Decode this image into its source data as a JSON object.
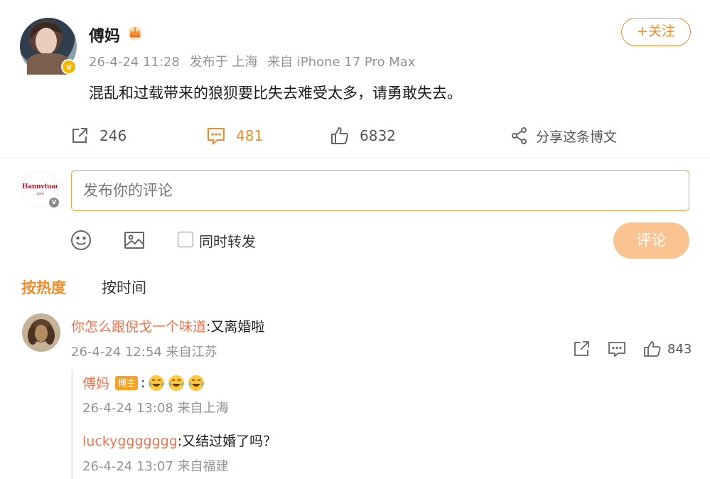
{
  "post": {
    "author": "傅妈",
    "verified_mark": "v",
    "time": "26-4-24 11:28",
    "published_in_prefix": "发布于",
    "location": "上海",
    "source_prefix": "来自",
    "device": "iPhone 17 Pro Max",
    "follow_label": "+关注",
    "text": "混乱和过载带来的狼狈要比失去难受太多，请勇敢失去。",
    "actions": {
      "repost_count": "246",
      "comment_count": "481",
      "like_count": "6832",
      "share_label": "分享这条博文"
    },
    "accent_color": "#f18a2b"
  },
  "composer": {
    "avatar_logo": "Hannvtuan",
    "avatar_logo_sub": ".com",
    "placeholder": "发布你的评论",
    "repost_checkbox_label": "同时转发",
    "submit_label": "评论"
  },
  "sort": {
    "hot_label": "按热度",
    "time_label": "按时间",
    "active": "hot"
  },
  "comments": [
    {
      "name": "你怎么跟倪戈一个味道",
      "separator": ":",
      "text": "又离婚啦",
      "time": "26-4-24 12:54",
      "source": "来自江苏",
      "like_count": "843",
      "replies": [
        {
          "name": "傅妈",
          "badge": "博主",
          "separator": ":",
          "emoji_icons": [
            "laugh-cry-icon",
            "laugh-cry-icon",
            "laugh-cry-icon"
          ],
          "time": "26-4-24 13:08",
          "source": "来自上海"
        },
        {
          "name": "luckyggggggg",
          "separator": ":",
          "text": "又结过婚了吗？",
          "time": "26-4-24 13:07",
          "source": "来自福建"
        }
      ]
    }
  ]
}
